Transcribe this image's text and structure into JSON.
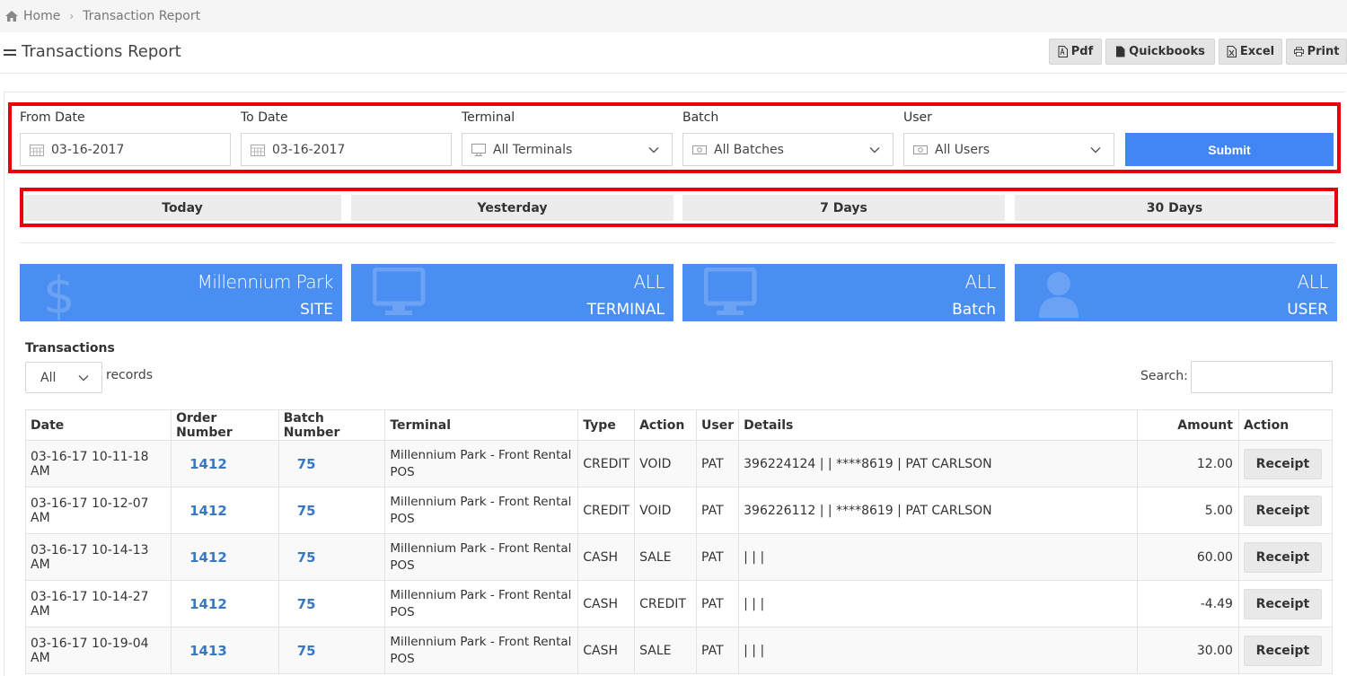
{
  "breadcrumb": {
    "home": "Home",
    "current": "Transaction Report"
  },
  "header": {
    "title": "Transactions Report",
    "actions": {
      "pdf": "Pdf",
      "quickbooks": "Quickbooks",
      "excel": "Excel",
      "print": "Print"
    }
  },
  "filters": {
    "from_date": {
      "label": "From Date",
      "value": "03-16-2017"
    },
    "to_date": {
      "label": "To Date",
      "value": "03-16-2017"
    },
    "terminal": {
      "label": "Terminal",
      "value": "All Terminals"
    },
    "batch": {
      "label": "Batch",
      "value": "All Batches"
    },
    "user": {
      "label": "User",
      "value": "All Users"
    },
    "submit": "Submit"
  },
  "quick_ranges": [
    "Today",
    "Yesterday",
    "7 Days",
    "30 Days"
  ],
  "cards": [
    {
      "value": "Millennium Park",
      "label": "SITE",
      "icon": "dollar-icon"
    },
    {
      "value": "ALL",
      "label": "TERMINAL",
      "icon": "monitor-icon"
    },
    {
      "value": "ALL",
      "label": "Batch",
      "icon": "monitor-icon"
    },
    {
      "value": "ALL",
      "label": "USER",
      "icon": "user-icon"
    }
  ],
  "transactions": {
    "title": "Transactions",
    "length_value": "All",
    "records_label": "records",
    "search_label": "Search:",
    "columns": [
      "Date",
      "Order Number",
      "Batch Number",
      "Terminal",
      "Type",
      "Action",
      "User",
      "Details",
      "Amount",
      "Action"
    ],
    "receipt_label": "Receipt",
    "rows": [
      {
        "date": "03-16-17 10-11-18 AM",
        "order": "1412",
        "batch": "75",
        "terminal": "Millennium Park - Front Rental POS",
        "type": "CREDIT",
        "action": "VOID",
        "user": "PAT",
        "details": "396224124 | | ****8619 | PAT CARLSON",
        "amount": "12.00"
      },
      {
        "date": "03-16-17 10-12-07 AM",
        "order": "1412",
        "batch": "75",
        "terminal": "Millennium Park - Front Rental POS",
        "type": "CREDIT",
        "action": "VOID",
        "user": "PAT",
        "details": "396226112 | | ****8619 | PAT CARLSON",
        "amount": "5.00"
      },
      {
        "date": "03-16-17 10-14-13 AM",
        "order": "1412",
        "batch": "75",
        "terminal": "Millennium Park - Front Rental POS",
        "type": "CASH",
        "action": "SALE",
        "user": "PAT",
        "details": "| | |",
        "amount": "60.00"
      },
      {
        "date": "03-16-17 10-14-27 AM",
        "order": "1412",
        "batch": "75",
        "terminal": "Millennium Park - Front Rental POS",
        "type": "CASH",
        "action": "CREDIT",
        "user": "PAT",
        "details": "| | |",
        "amount": "-4.49"
      },
      {
        "date": "03-16-17 10-19-04 AM",
        "order": "1413",
        "batch": "75",
        "terminal": "Millennium Park - Front Rental POS",
        "type": "CASH",
        "action": "SALE",
        "user": "PAT",
        "details": "| | |",
        "amount": "30.00"
      }
    ]
  },
  "colors": {
    "accent": "#4285f4",
    "card": "#4a8ef2",
    "highlight": "#e8000b",
    "link": "#3a78c2"
  }
}
